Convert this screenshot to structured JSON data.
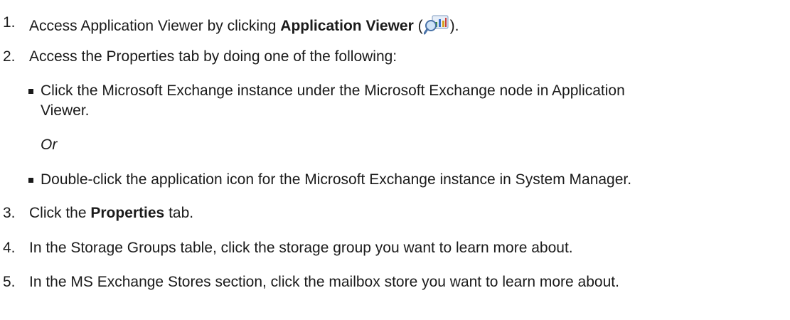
{
  "steps": [
    {
      "number": "1.",
      "pre": "Access Application Viewer by clicking ",
      "bold": "Application Viewer",
      "open_paren": " (",
      "icon": "application-viewer-icon",
      "post": ")."
    },
    {
      "number": "2.",
      "text": "Access the Properties tab by doing one of the following:",
      "options": [
        {
          "line1": "Click the Microsoft Exchange instance under the Microsoft Exchange node in Application",
          "line2": "Viewer."
        },
        {
          "line1": "Double-click the application icon for the Microsoft Exchange instance in System Manager."
        }
      ],
      "separator": "Or"
    },
    {
      "number": "3.",
      "pre": "Click the ",
      "bold": "Properties",
      "post": " tab."
    },
    {
      "number": "4.",
      "text": "In the Storage Groups table, click the storage group you want to learn more about."
    },
    {
      "number": "5.",
      "text": "In the MS Exchange Stores section, click the mailbox store you want to learn more about."
    }
  ]
}
